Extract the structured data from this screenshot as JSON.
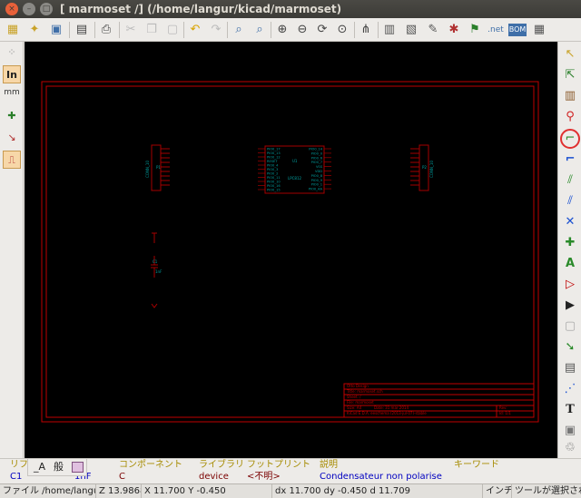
{
  "window": {
    "title": "[ marmoset /] (/home/langur/kicad/marmoset)",
    "close": "×",
    "minimize": "–",
    "maximize": "□"
  },
  "left_toolbar": {
    "units_in": "In",
    "units_mm": "mm"
  },
  "schematic": {
    "connector_left": "CONN_10",
    "connector_left_ref": "P1",
    "connector_right": "CONN_10",
    "connector_right_ref": "P2",
    "mcu_ref": "U1",
    "mcu_value": "LPC812",
    "mcu_pins_left": [
      "PIO0_17",
      "PIO0_13",
      "PIO0_12",
      "RESET",
      "PIO0_4",
      "PIO0_3",
      "PIO0_2",
      "PIO0_11",
      "PIO0_10",
      "PIO0_16",
      "PIO0_15"
    ],
    "mcu_pins_right": [
      "PIO0_14",
      "PIO0_0",
      "PIO0_6",
      "PIO0_7",
      "VSS",
      "VDD",
      "PIO0_8",
      "PIO0_9",
      "PIO0_1",
      "PIO0_AA"
    ],
    "cap_ref": "C1",
    "cap_value": "1nF",
    "title_block": {
      "company": "Otto Design",
      "title": "Title: marmoset.sch",
      "sheet": "Sheet: /",
      "file": "File: marmoset",
      "size": "Size: A4",
      "date": "Date: 31 mar 2014",
      "rev": "Rev:",
      "kicad": "KiCad E.D.A.  eeschema (2013-jul-07)-stable",
      "id": "Id: 1/1"
    }
  },
  "message_panel": {
    "col1_header": "リフ",
    "col1_value": "C1",
    "tab_label_a": "_A",
    "tab_label_b": "般",
    "col2_header": "前",
    "col2_value": "1nF",
    "col3_header": "コンポーネント",
    "col3_value": "C",
    "col4_header": "ライブラリ",
    "col4_value": "device",
    "col5_header": "フットプリント",
    "col5_value": "<不明>",
    "col6_header": "説明",
    "col6_value": "Condensateur non polarise",
    "col7_header": "キーワード",
    "col7_value": ""
  },
  "status_bar": {
    "file": "ファイル /home/langur",
    "zoom": "Z 13.9868",
    "cursor": "X 11.700  Y -0.450",
    "delta": "dx 11.700  dy -0.450  d 11.709",
    "units": "インチ",
    "tool": "ツールが選択され"
  },
  "colors": {
    "canvas_bg": "#000000",
    "sheet_border": "#c00000",
    "component": "#a50000",
    "pin_text": "#00a0a0",
    "accent_highlight": "#e03030"
  }
}
